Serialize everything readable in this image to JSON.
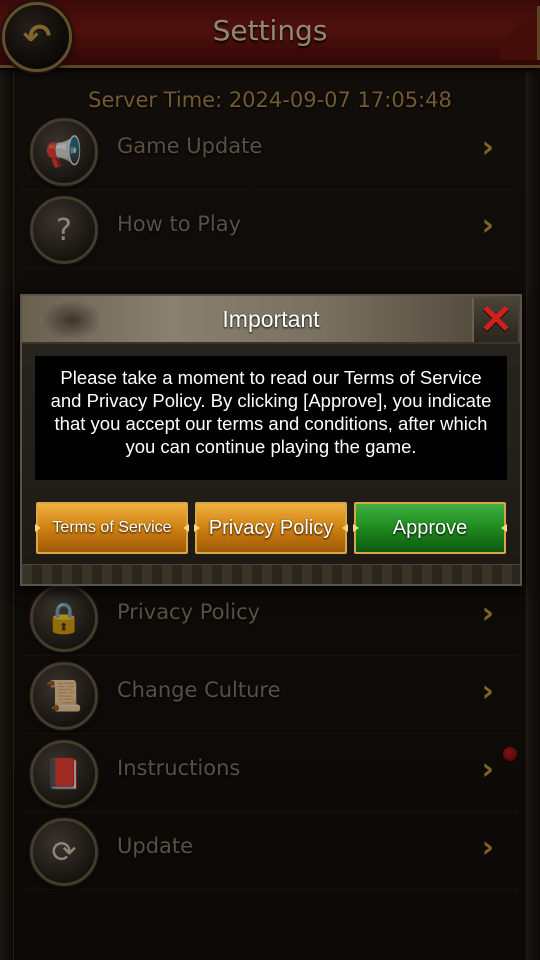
{
  "header": {
    "title": "Settings",
    "back_icon": "back-swirl-icon"
  },
  "server_time": "Server Time: 2024-09-07 17:05:48",
  "menu": [
    {
      "label": "Game Update",
      "icon": "megaphone-icon"
    },
    {
      "label": "How to Play",
      "icon": "question-icon"
    },
    {
      "label": "Privacy Policy",
      "icon": "lock-scroll-icon"
    },
    {
      "label": "Change Culture",
      "icon": "scroll-icon"
    },
    {
      "label": "Instructions",
      "icon": "book-question-icon"
    },
    {
      "label": "Update",
      "icon": "refresh-icon"
    }
  ],
  "modal": {
    "title": "Important",
    "body": "Please take a moment to read our Terms of Service and Privacy Policy. By clicking [Approve], you indicate that you accept our terms and conditions, after which you can continue playing the game.",
    "buttons": {
      "terms": "Terms of Service",
      "privacy": "Privacy Policy",
      "approve": "Approve"
    }
  },
  "colors": {
    "header_red": "#7a1a14",
    "gold_text": "#b08a4a",
    "close_red": "#d02020",
    "approve_green": "#1e8a1e",
    "gold_button": "#d08010"
  }
}
